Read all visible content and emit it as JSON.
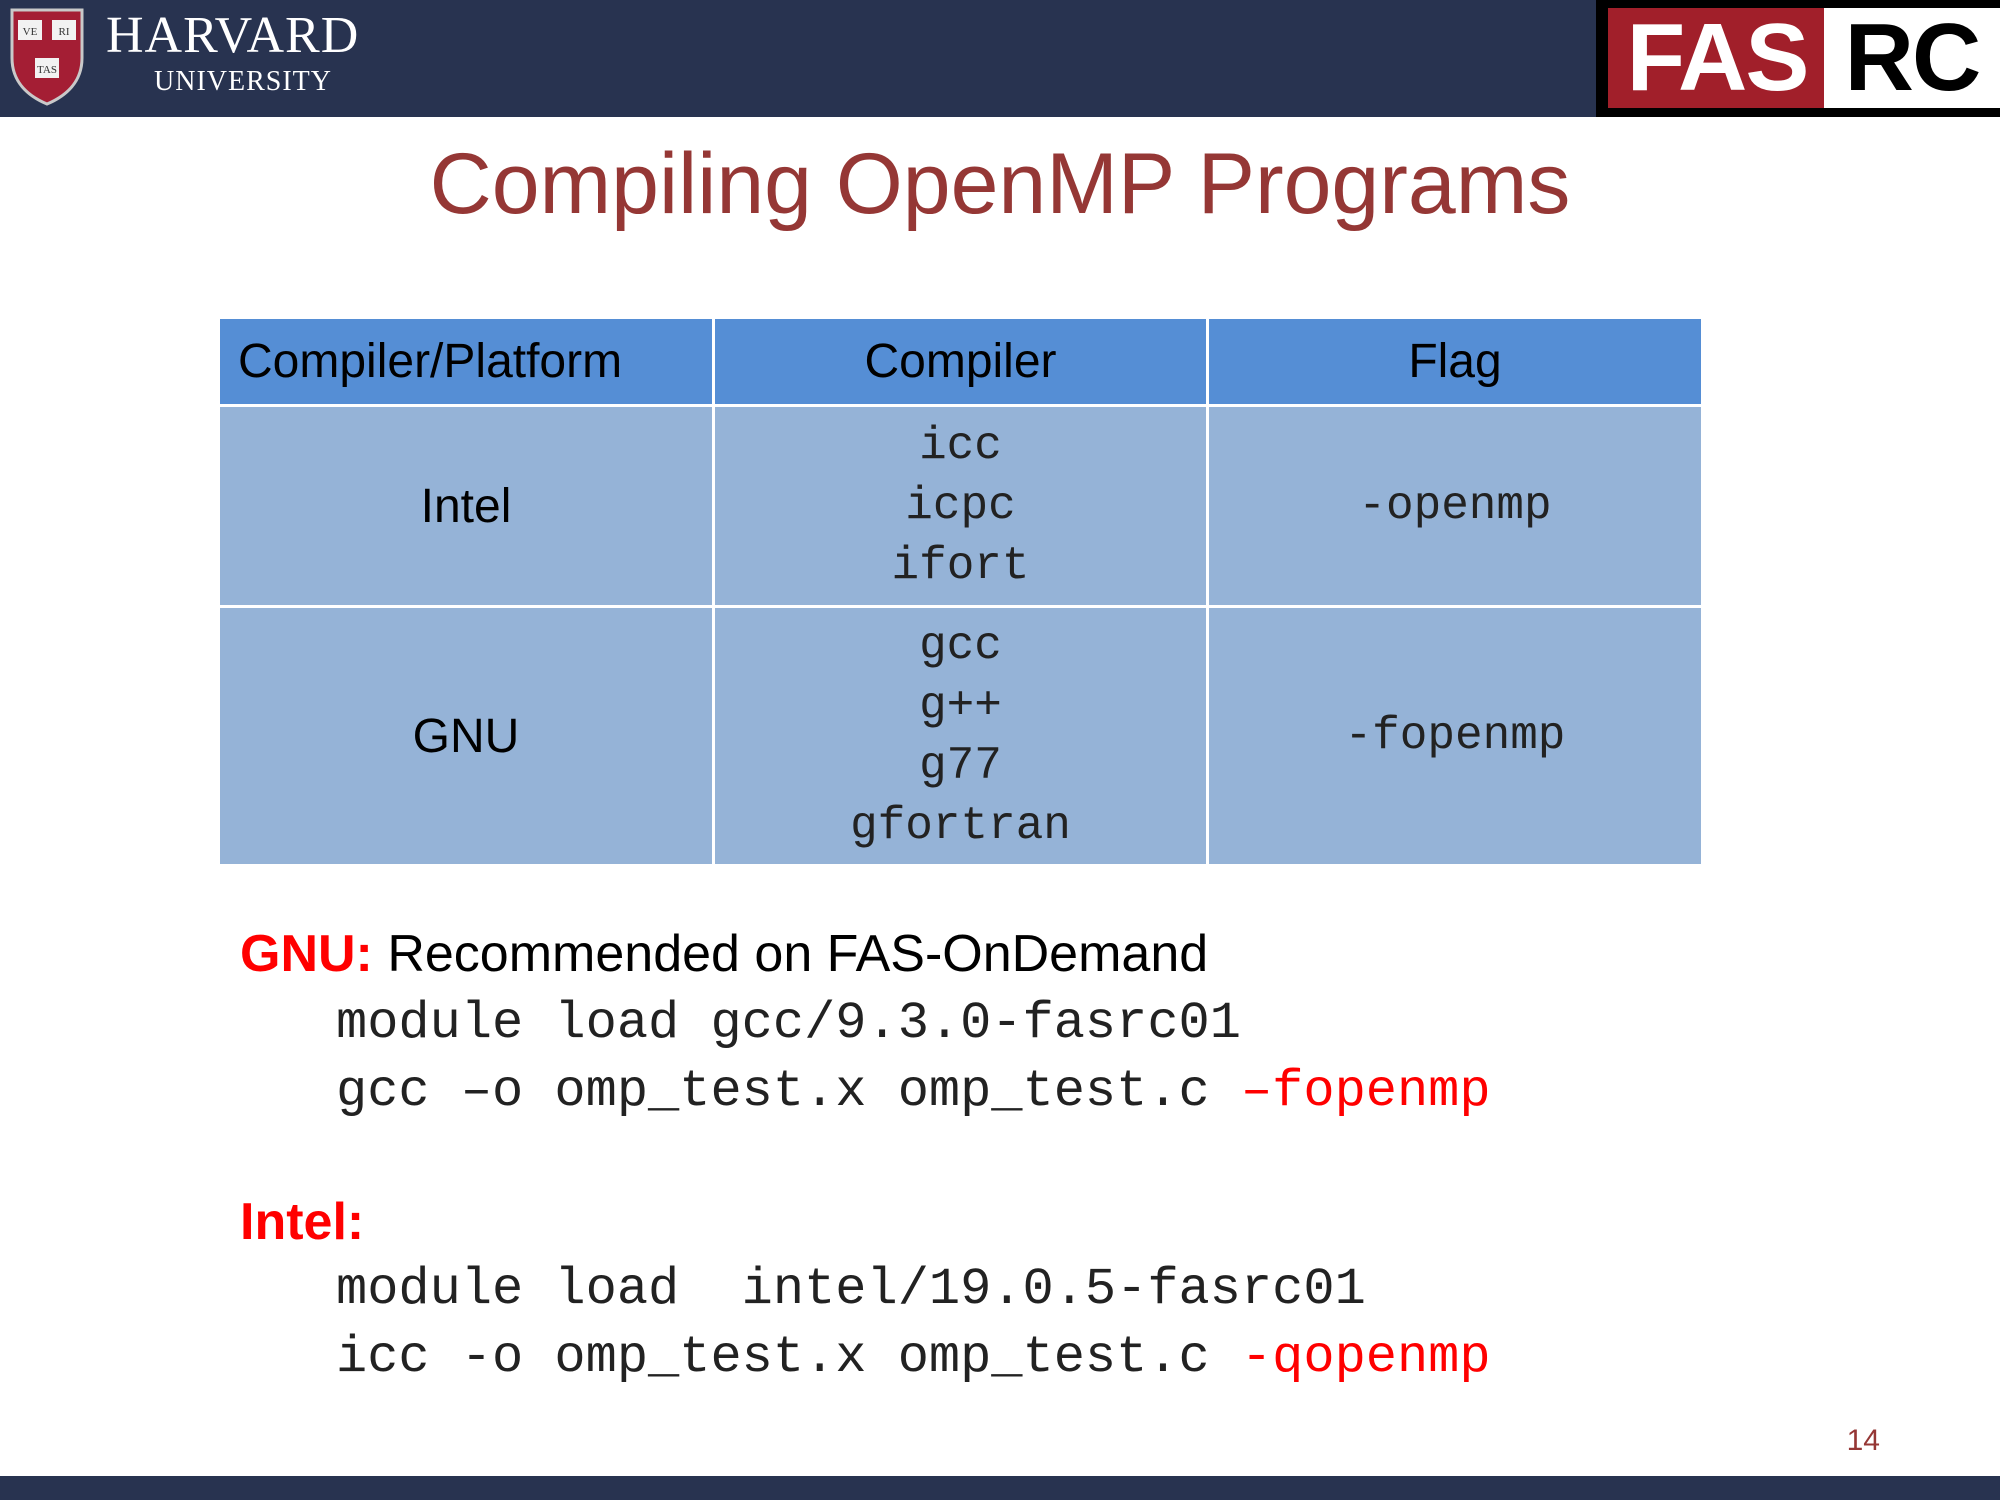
{
  "header": {
    "university_name": "HARVARD",
    "university_sub": "UNIVERSITY",
    "shield_text": [
      "VE",
      "RI",
      "TAS"
    ],
    "logo_left": "FAS",
    "logo_right": "RC"
  },
  "title": "Compiling OpenMP Programs",
  "table": {
    "headers": [
      "Compiler/Platform",
      "Compiler",
      "Flag"
    ],
    "rows": [
      {
        "platform": "Intel",
        "compilers": [
          "icc",
          "icpc",
          "ifort"
        ],
        "flag": "-openmp"
      },
      {
        "platform": "GNU",
        "compilers": [
          "gcc",
          "g++",
          "g77",
          "gfortran"
        ],
        "flag": "-fopenmp"
      }
    ]
  },
  "gnu": {
    "label": "GNU:",
    "note": " Recommended on FAS-OnDemand",
    "line1": "module load gcc/9.3.0-fasrc01",
    "line2_cmd": "gcc –o omp_test.x omp_test.c ",
    "line2_flag": "–fopenmp"
  },
  "intel": {
    "label": "Intel:",
    "line1": "module load  intel/19.0.5-fasrc01",
    "line2_cmd": "icc -o omp_test.x omp_test.c ",
    "line2_flag": "-qopenmp"
  },
  "page_number": "14",
  "colors": {
    "header_bg": "#283350",
    "title": "#953735",
    "table_header": "#558ed5",
    "table_body": "#95b3d7",
    "accent_red": "#ff0000"
  }
}
